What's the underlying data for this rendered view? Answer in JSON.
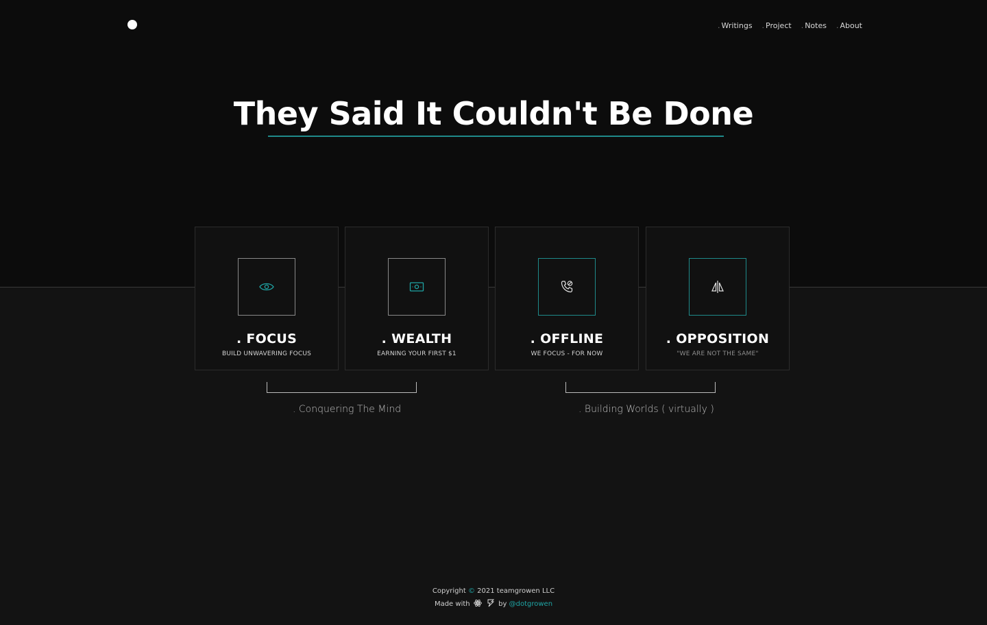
{
  "nav": {
    "items": [
      {
        "label": "Writings"
      },
      {
        "label": "Project"
      },
      {
        "label": "Notes"
      },
      {
        "label": "About"
      }
    ]
  },
  "hero": {
    "title": "They Said It Couldn't Be Done"
  },
  "cards": [
    {
      "title": ". FOCUS",
      "subtitle": "BUILD UNWAVERING FOCUS",
      "icon": "eye-icon"
    },
    {
      "title": ". WEALTH",
      "subtitle": "EARNING YOUR FIRST $1",
      "icon": "cash-icon"
    },
    {
      "title": ". OFFLINE",
      "subtitle": "WE FOCUS - FOR NOW",
      "icon": "phone-off-icon"
    },
    {
      "title": ". OPPOSITION",
      "subtitle": "\"WE ARE NOT THE SAME\"",
      "icon": "flip-icon"
    }
  ],
  "groups": [
    {
      "label": ". Conquering The Mind"
    },
    {
      "label": ". Building Worlds ( virtually )"
    }
  ],
  "footer": {
    "copyright_prefix": "Copyright",
    "copyright_symbol": "©",
    "copyright_suffix": "2021 teamgrowen LLC",
    "made_with": "Made with",
    "by": "by",
    "handle": "@dotgrowen"
  },
  "colors": {
    "accent": "#1f8b8b",
    "background": "#0c0c0c",
    "band": "#131313"
  }
}
